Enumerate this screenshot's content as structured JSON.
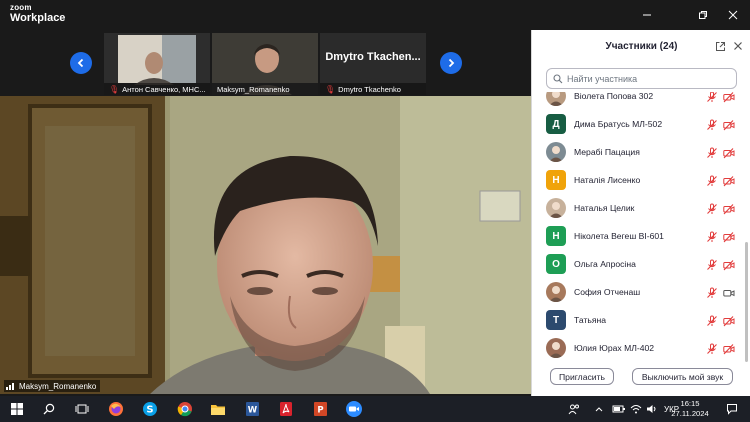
{
  "app": {
    "brand_line1": "zoom",
    "brand_line2": "Workplace"
  },
  "gallery": {
    "prev_icon": "chevron-left-icon",
    "next_icon": "chevron-right-icon",
    "tiles": [
      {
        "label": "Антон Савченко, МНС...",
        "muted": true
      },
      {
        "label": "Maksym_Romanenko",
        "muted": false
      },
      {
        "big_name": "Dmytro  Tkachen...",
        "label": "Dmytro Tkachenko",
        "muted": true
      }
    ]
  },
  "main_video": {
    "name": "Maksym_Romanenko"
  },
  "panel": {
    "title": "Участники (24)",
    "search_placeholder": "Найти участника",
    "participants": [
      {
        "name": "Віолета Попова 302",
        "avatar": "photo",
        "color": "#b89a80",
        "mic_muted": true,
        "cam_off": true
      },
      {
        "name": "Дима Братусь МЛ-502",
        "avatar": "letter",
        "letter": "Д",
        "color": "#175d43",
        "mic_muted": true,
        "cam_off": true
      },
      {
        "name": "Мерабі Пацация",
        "avatar": "photo",
        "color": "#7d8b93",
        "mic_muted": true,
        "cam_off": true
      },
      {
        "name": "Наталія Лисенко",
        "avatar": "letter",
        "letter": "Н",
        "color": "#f0a30a",
        "mic_muted": true,
        "cam_off": true
      },
      {
        "name": "Наталья Целик",
        "avatar": "photo",
        "color": "#c7b19b",
        "mic_muted": true,
        "cam_off": true
      },
      {
        "name": "Ніколета Вегеш ВІ-601",
        "avatar": "letter",
        "letter": "Н",
        "color": "#1e9e55",
        "mic_muted": true,
        "cam_off": true
      },
      {
        "name": "Ольга Апросіна",
        "avatar": "letter",
        "letter": "О",
        "color": "#1e9e55",
        "mic_muted": true,
        "cam_off": true
      },
      {
        "name": "София Отченаш",
        "avatar": "photo",
        "color": "#a7795c",
        "mic_muted": true,
        "cam_off": false
      },
      {
        "name": "Татьяна",
        "avatar": "letter",
        "letter": "Т",
        "color": "#2c4a6e",
        "mic_muted": true,
        "cam_off": true
      },
      {
        "name": "Юлия Юрах МЛ-402",
        "avatar": "photo",
        "color": "#9a6b55",
        "mic_muted": true,
        "cam_off": true
      }
    ],
    "invite_label": "Пригласить",
    "mute_self_label": "Выключить мой звук"
  },
  "taskbar": {
    "lang": "УКР",
    "time": "16:15",
    "date": "27.11.2024"
  },
  "colors": {
    "accent": "#1e6ce8",
    "muted_red": "#e23c3c"
  }
}
